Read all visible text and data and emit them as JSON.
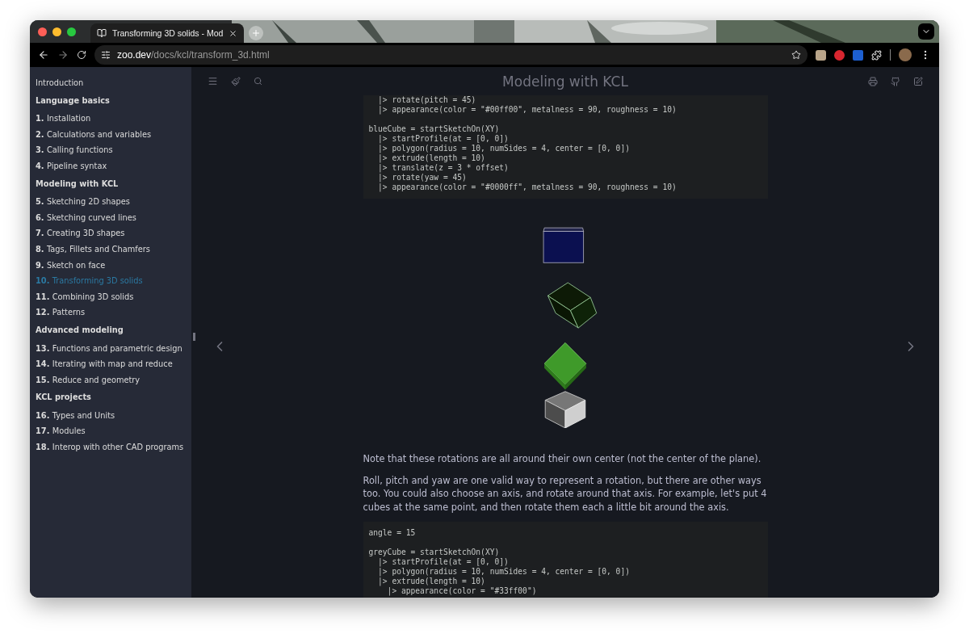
{
  "browser": {
    "tab": {
      "title": "Transforming 3D solids - Mod",
      "selected": true
    },
    "url": {
      "domain": "zoo.dev",
      "path": "/docs/kcl/transform_3d.html"
    }
  },
  "book": {
    "title": "Modeling with KCL"
  },
  "sidebar": {
    "items": [
      {
        "kind": "link",
        "label": "Introduction",
        "selected": false
      },
      {
        "kind": "heading",
        "label": "Language basics"
      },
      {
        "kind": "link",
        "number": "1.",
        "label": "Installation",
        "selected": false
      },
      {
        "kind": "link",
        "number": "2.",
        "label": "Calculations and variables",
        "selected": false
      },
      {
        "kind": "link",
        "number": "3.",
        "label": "Calling functions",
        "selected": false
      },
      {
        "kind": "link",
        "number": "4.",
        "label": "Pipeline syntax",
        "selected": false
      },
      {
        "kind": "heading",
        "label": "Modeling with KCL"
      },
      {
        "kind": "link",
        "number": "5.",
        "label": "Sketching 2D shapes",
        "selected": false
      },
      {
        "kind": "link",
        "number": "6.",
        "label": "Sketching curved lines",
        "selected": false
      },
      {
        "kind": "link",
        "number": "7.",
        "label": "Creating 3D shapes",
        "selected": false
      },
      {
        "kind": "link",
        "number": "8.",
        "label": "Tags, Fillets and Chamfers",
        "selected": false
      },
      {
        "kind": "link",
        "number": "9.",
        "label": "Sketch on face",
        "selected": false
      },
      {
        "kind": "link",
        "number": "10.",
        "label": "Transforming 3D solids",
        "selected": true
      },
      {
        "kind": "link",
        "number": "11.",
        "label": "Combining 3D solids",
        "selected": false
      },
      {
        "kind": "link",
        "number": "12.",
        "label": "Patterns",
        "selected": false
      },
      {
        "kind": "heading",
        "label": "Advanced modeling"
      },
      {
        "kind": "link",
        "number": "13.",
        "label": "Functions and parametric design",
        "selected": false
      },
      {
        "kind": "link",
        "number": "14.",
        "label": "Iterating with map and reduce",
        "selected": false
      },
      {
        "kind": "link",
        "number": "15.",
        "label": "Reduce and geometry",
        "selected": false
      },
      {
        "kind": "heading",
        "label": "KCL projects"
      },
      {
        "kind": "link",
        "number": "16.",
        "label": "Types and Units",
        "selected": false
      },
      {
        "kind": "link",
        "number": "17.",
        "label": "Modules",
        "selected": false
      },
      {
        "kind": "link",
        "number": "18.",
        "label": "Interop with other CAD programs",
        "selected": false
      }
    ]
  },
  "content": [
    {
      "kind": "code",
      "groups": [
        [
          "  |> rotate(pitch = 45)",
          "  |> appearance(color = \"#00ff00\", metalness = 90, roughness = 10)"
        ],
        [
          "blueCube = startSketchOn(XY)",
          "  |> startProfile(at = [0, 0])",
          "  |> polygon(radius = 10, numSides = 4, center = [0, 0])",
          "  |> extrude(length = 10)",
          "  |> translate(z = 3 * offset)",
          "  |> rotate(yaw = 45)",
          "  |> appearance(color = \"#0000ff\", metalness = 90, roughness = 10)"
        ]
      ]
    },
    {
      "kind": "render"
    },
    {
      "kind": "paragraph",
      "text": "Note that these rotations are all around their own center (not the center of the plane)."
    },
    {
      "kind": "paragraph",
      "text": "Roll, pitch and yaw are one valid way to represent a rotation, but there are other ways too. You could also choose an axis, and rotate around that axis. For example, let's put 4 cubes at the same point, and then rotate them each a little bit around the axis."
    },
    {
      "kind": "code",
      "groups": [
        [
          "angle = 15"
        ],
        [
          "greyCube = startSketchOn(XY)",
          "  |> startProfile(at = [0, 0])",
          "  |> polygon(radius = 10, numSides = 4, center = [0, 0])",
          "  |> extrude(length = 10)",
          "    |> appearance(color = \"#33ff00\")"
        ]
      ]
    }
  ]
}
